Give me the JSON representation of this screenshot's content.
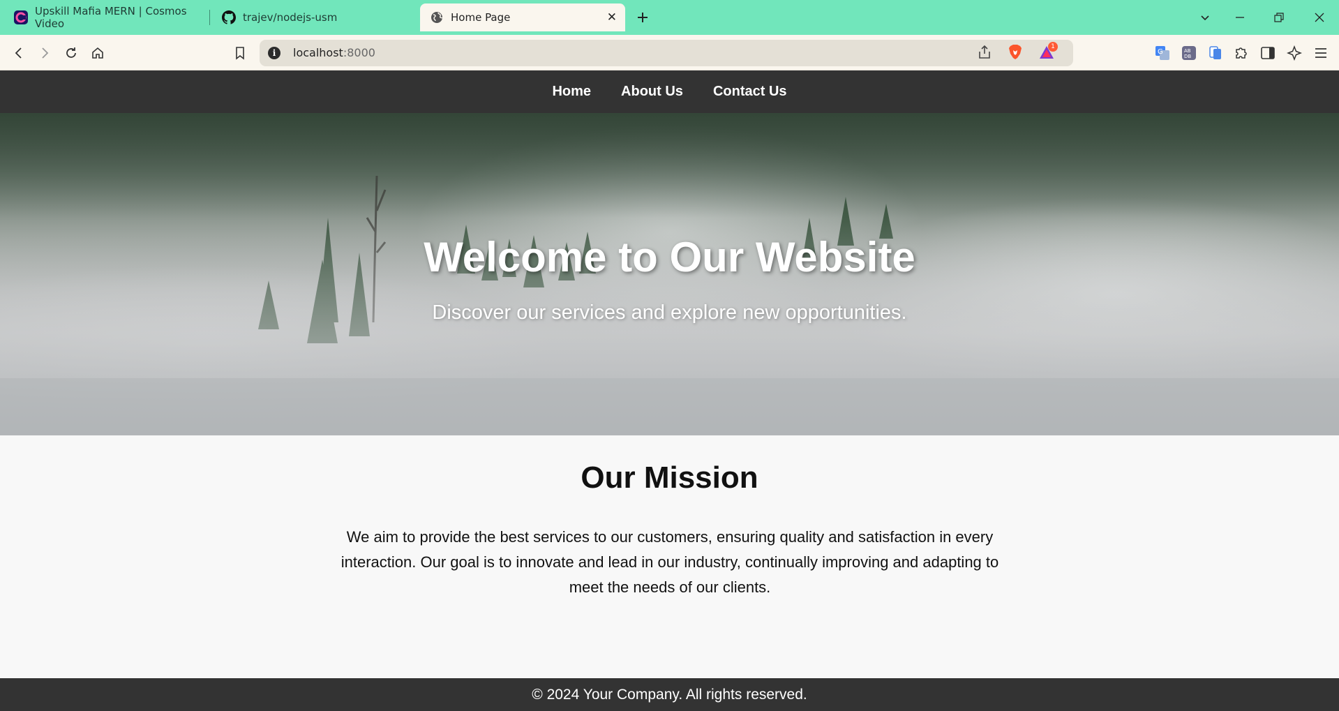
{
  "browser": {
    "tabs": [
      {
        "title": "Upskill Mafia MERN | Cosmos Video",
        "icon": "cosmos-icon",
        "active": false
      },
      {
        "title": "trajev/nodejs-usm",
        "icon": "github-icon",
        "active": false
      },
      {
        "title": "Home Page",
        "icon": "globe-icon",
        "active": true
      }
    ],
    "address": {
      "host": "localhost",
      "port": ":8000"
    },
    "notification_count": "1",
    "accent": "#71e6bb"
  },
  "page": {
    "nav": {
      "items": [
        "Home",
        "About Us",
        "Contact Us"
      ]
    },
    "hero": {
      "title": "Welcome to Our Website",
      "subtitle": "Discover our services and explore new opportunities."
    },
    "mission": {
      "title": "Our Mission",
      "text": "We aim to provide the best services to our customers, ensuring quality and satisfaction in every interaction. Our goal is to innovate and lead in our industry, continually improving and adapting to meet the needs of our clients."
    },
    "footer": {
      "text": "© 2024 Your Company. All rights reserved."
    }
  }
}
